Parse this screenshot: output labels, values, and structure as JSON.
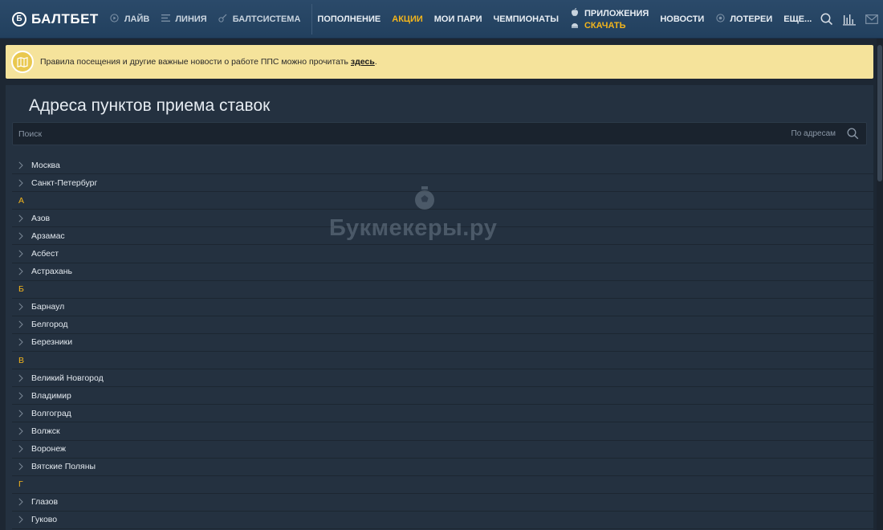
{
  "header": {
    "logo_text": "БАЛТБЕТ",
    "logo_icon": "baltbet-b-icon",
    "nav_left": [
      {
        "label": "ЛАЙВ",
        "icon": "play-circle-icon"
      },
      {
        "label": "ЛИНИЯ",
        "icon": "list-icon"
      },
      {
        "label": "БАЛТСИСТЕМА",
        "icon": "guitar-icon"
      }
    ],
    "nav_main": [
      {
        "label": "ПОПОЛНЕНИЕ",
        "accent": false
      },
      {
        "label": "АКЦИИ",
        "accent": true
      },
      {
        "label": "МОИ ПАРИ",
        "accent": false
      },
      {
        "label": "ЧЕМПИОНАТЫ",
        "accent": false
      }
    ],
    "apps": {
      "label": "ПРИЛОЖЕНИЯ",
      "download_label": "СКАЧАТЬ"
    },
    "nav_tail": [
      {
        "label": "НОВОСТИ",
        "icon": ""
      },
      {
        "label": "ЛОТЕРЕИ",
        "icon": "lottery-ball-icon"
      },
      {
        "label": "ЕЩЕ...",
        "icon": ""
      }
    ],
    "right_icons": [
      "search-icon",
      "stats-icon",
      "mail-icon"
    ]
  },
  "notice": {
    "text": "Правила посещения и другие важные новости о работе ППС можно прочитать ",
    "link": "здесь",
    "after": "."
  },
  "main": {
    "title": "Адреса пунктов приема ставок",
    "search": {
      "placeholder": "Поиск",
      "mode": "По адресам"
    },
    "list": [
      {
        "type": "city",
        "name": "Москва"
      },
      {
        "type": "city",
        "name": "Санкт-Петербург"
      },
      {
        "type": "letter",
        "name": "А"
      },
      {
        "type": "city",
        "name": "Азов"
      },
      {
        "type": "city",
        "name": "Арзамас"
      },
      {
        "type": "city",
        "name": "Асбест"
      },
      {
        "type": "city",
        "name": "Астрахань"
      },
      {
        "type": "letter",
        "name": "Б"
      },
      {
        "type": "city",
        "name": "Барнаул"
      },
      {
        "type": "city",
        "name": "Белгород"
      },
      {
        "type": "city",
        "name": "Березники"
      },
      {
        "type": "letter",
        "name": "В"
      },
      {
        "type": "city",
        "name": "Великий Новгород"
      },
      {
        "type": "city",
        "name": "Владимир"
      },
      {
        "type": "city",
        "name": "Волгоград"
      },
      {
        "type": "city",
        "name": "Волжск"
      },
      {
        "type": "city",
        "name": "Воронеж"
      },
      {
        "type": "city",
        "name": "Вятские Поляны"
      },
      {
        "type": "letter",
        "name": "Г"
      },
      {
        "type": "city",
        "name": "Глазов"
      },
      {
        "type": "city",
        "name": "Гуково"
      }
    ]
  },
  "watermark": {
    "text": "Букмекеры.ру"
  },
  "colors": {
    "accent": "#f3b51c",
    "header": "#22405e",
    "panel": "#243140",
    "notice": "#f5e39b"
  }
}
